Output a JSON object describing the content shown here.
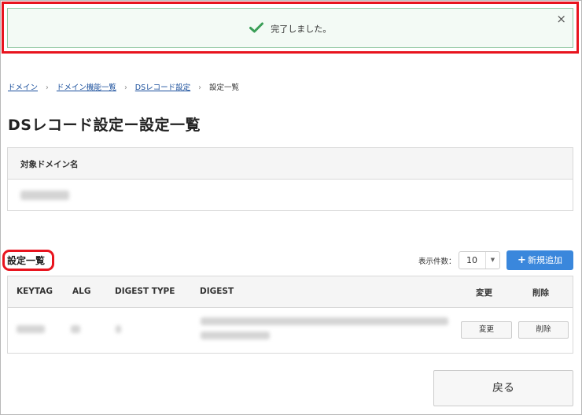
{
  "alert": {
    "message": "完了しました。",
    "close_glyph": "×",
    "check_color": "#3a9e57"
  },
  "breadcrumb": {
    "items": [
      "ドメイン",
      "ドメイン機能一覧",
      "DSレコード設定",
      "設定一覧"
    ],
    "separator": "›"
  },
  "page_title": "DSレコード設定ー設定一覧",
  "domain_box": {
    "header": "対象ドメイン名"
  },
  "settings": {
    "title": "設定一覧",
    "count_label": "表示件数：",
    "count_value": "10",
    "dropdown_icon": "▼",
    "add_button": {
      "icon": "+",
      "label": "新規追加"
    },
    "table": {
      "headers": {
        "keytag": "KEYTAG",
        "alg": "ALG",
        "digest_type": "DIGEST TYPE",
        "digest": "DIGEST",
        "change": "変更",
        "delete": "削除"
      },
      "row": {
        "change_button": "変更",
        "delete_button": "削除"
      }
    }
  },
  "back_button": "戻る",
  "colors": {
    "accent": "#3a87dc",
    "highlight": "#e8141e",
    "alert_bg": "#f3faf5",
    "link": "#1a4f9c"
  }
}
